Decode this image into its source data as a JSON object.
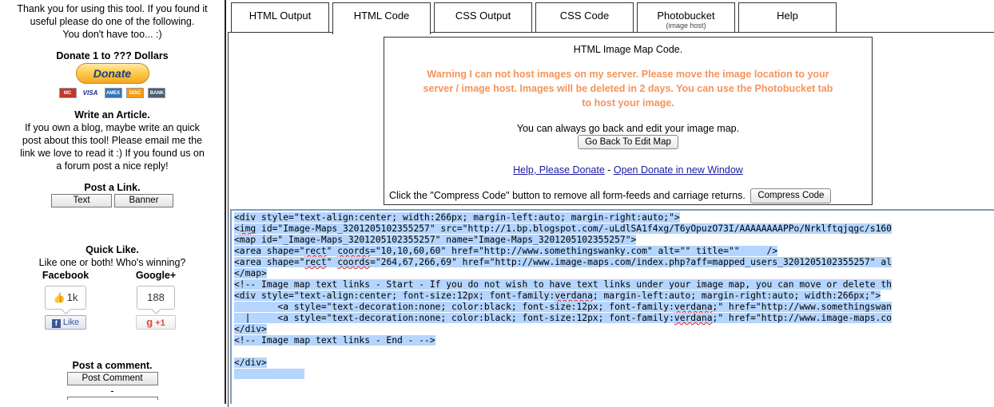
{
  "sidebar": {
    "thanks_line1": "Thank you for using this tool. If you found it",
    "thanks_line2": "useful please do one of the following.",
    "thanks_line3": "You don't have too... :)",
    "donate_heading": "Donate 1 to ??? Dollars",
    "donate_button": "Donate",
    "cards": {
      "mastercard": "MC",
      "visa": "VISA",
      "amex": "AMEX",
      "discover": "DISC",
      "bank": "BANK"
    },
    "article_heading": "Write an Article.",
    "article_line1": "If you own a blog, maybe write an quick",
    "article_line2": "post about this tool! Please email me the",
    "article_line3": "link we love to read it :) If you found us on",
    "article_line4": "a forum post a nice reply!",
    "link_heading": "Post a Link.",
    "link_text_button": "Text",
    "link_banner_button": "Banner",
    "quick_heading": "Quick Like.",
    "quick_sub": "Like one or both! Who's winning?",
    "facebook_label": "Facebook",
    "facebook_count": "1k",
    "facebook_like": "Like",
    "google_label": "Google+",
    "google_count": "188",
    "google_button": "+1",
    "comment_heading": "Post a comment.",
    "comment_button": "Post Comment",
    "comment_dash": "-"
  },
  "tabs": [
    {
      "label": "HTML Output",
      "sub": ""
    },
    {
      "label": "HTML Code",
      "sub": ""
    },
    {
      "label": "CSS Output",
      "sub": ""
    },
    {
      "label": "CSS Code",
      "sub": ""
    },
    {
      "label": "Photobucket",
      "sub": "(image host)"
    },
    {
      "label": "Help",
      "sub": ""
    }
  ],
  "active_tab": "HTML Code",
  "info": {
    "title": "HTML Image Map Code.",
    "warning_line1": "Warning I can not host images on my server. Please move the image location to your",
    "warning_line2": "server / image host. Images will be deleted in 2 days. You can use the Photobucket tab",
    "warning_line3": "to host your image.",
    "go_back_text": "You can always go back and edit your image map.",
    "go_back_button": "Go Back To Edit Map",
    "help_link": "Help, Please Donate",
    "separator": " - ",
    "donate_window_link": "Open Donate in new Window",
    "compress_text": "Click the \"Compress Code\" button to remove all form-feeds and carriage returns.",
    "compress_button": "Compress Code"
  },
  "colors": {
    "warning": "#f4935a",
    "selection": "#b4d5fe",
    "link": "#1a1aa6"
  },
  "code": {
    "l1": "<div style=\"text-align:center; width:266px; margin-left:auto; margin-right:auto;\">",
    "l2a": "<",
    "l2b": "img",
    "l2c": " id=\"Image-Maps_3201205102355257\" src=\"http://1.bp.blogspot.com/-uLdlSA1f4xg/T6yOpuzO73I/AAAAAAAAPPo/Nrklftqjqgc/s160",
    "l3": "<map id=\"_Image-Maps_3201205102355257\" name=\"Image-Maps_3201205102355257\">",
    "l4a": "<area shape=\"",
    "l4b": "rect",
    "l4c": "\" ",
    "l4d": "coords",
    "l4e": "=\"10,10,60,60\" href=\"http://www.somethingswanky.com\" alt=\"\" title=\"\"     />",
    "l5a": "<area shape=\"",
    "l5b": "rect",
    "l5c": "\" ",
    "l5d": "coords",
    "l5e": "=\"264,67,266,69\" href=\"http://www.image-maps.com/index.php?aff=mapped_users_3201205102355257\" al",
    "l6": "</map>",
    "l7": "<!-- Image map text links - Start - If you do not wish to have text links under your image map, you can move or delete th",
    "l8a": "<div style=\"text-align:center; font-size:12px; font-family:",
    "l8b": "verdana",
    "l8c": "; margin-left:auto; margin-right:auto; width:266px;\">",
    "l9a": "        <a style=\"text-decoration:none; color:black; font-size:12px; font-family:",
    "l9b": "verdana",
    "l9c": ";\" href=\"http://www.somethingswan",
    "l10a": "  |     <a style=\"text-decoration:none; color:black; font-size:12px; font-family:",
    "l10b": "verdana",
    "l10c": ";\" href=\"http://www.image-maps.co",
    "l11": "</div>",
    "l12": "<!-- Image map text links - End - -->",
    "l13": "",
    "l14": "</div>",
    "l15": "             "
  }
}
